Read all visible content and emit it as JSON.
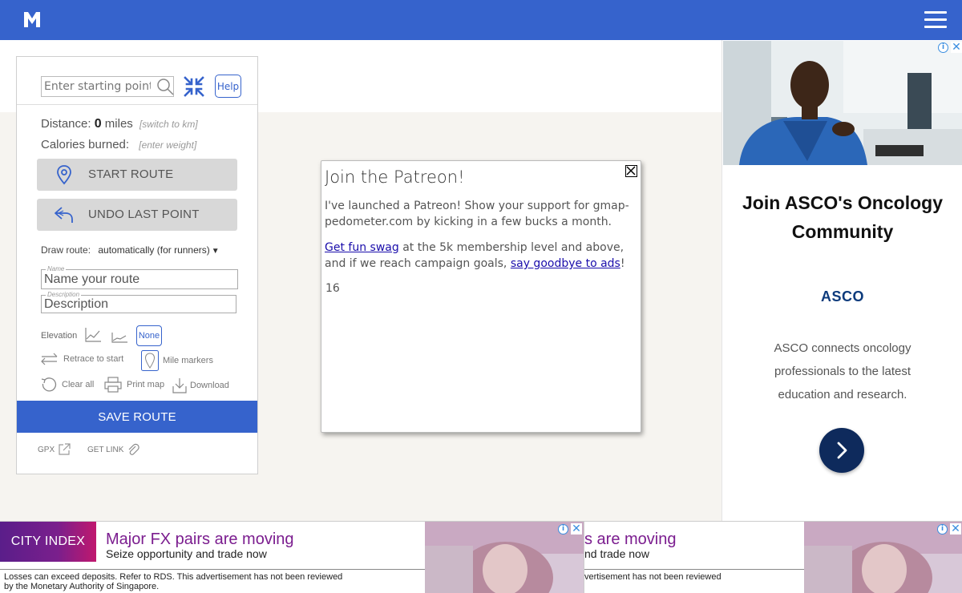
{
  "topbar": {
    "logo_text": "M",
    "brand_color": "#3663cc"
  },
  "panel": {
    "search_placeholder": "Enter starting point",
    "help_label": "Help",
    "distance_label": "Distance:",
    "distance_value": "0",
    "distance_unit": "miles",
    "switch_units_link": "[switch to km]",
    "calories_label": "Calories burned:",
    "enter_weight_link": "[enter weight]",
    "start_route_label": "START ROUTE",
    "undo_label": "UNDO LAST POINT",
    "draw_route_label": "Draw route:",
    "draw_route_value": "automatically (for runners)",
    "name_field_label": "Name",
    "name_placeholder": "Name your route",
    "description_field_label": "Description",
    "description_placeholder": "Description",
    "elevation_label": "Elevation",
    "elevation_none_label": "None",
    "retrace_label": "Retrace to start",
    "mile_markers_label": "Mile markers",
    "clear_all_label": "Clear all",
    "print_map_label": "Print map",
    "download_label": "Download",
    "save_route_label": "SAVE ROUTE",
    "gpx_label": "GPX",
    "get_link_label": "GET LINK"
  },
  "modal": {
    "title": "Join the Patreon!",
    "paragraph1": "I've launched a Patreon! Show your support for gmap-pedometer.com by kicking in a few bucks a month.",
    "p2_link1": "Get fun swag",
    "p2_middle": " at the 5k membership level and above, and if we reach campaign goals, ",
    "p2_link2": "say goodbye to ads",
    "p2_end": "!",
    "counter": "16"
  },
  "right_ad": {
    "headline": "Join ASCO's Oncology Community",
    "brand": "ASCO",
    "body": "ASCO connects oncology professionals to the latest education and research.",
    "cta_icon": "chevron-right-icon"
  },
  "bottom_ad": {
    "logo": "CITY INDEX",
    "headline": "Major FX pairs are moving",
    "subline": "Seize opportunity and trade now",
    "disclaimer_line1": "Losses can exceed deposits. Refer to RDS. This advertisement has not been reviewed",
    "disclaimer_line2": "by the Monetary Authority of Singapore.",
    "headline_clip": "s are moving",
    "subline_clip": "nd trade now",
    "disclaimer_clip": "vertisement has not been reviewed"
  }
}
